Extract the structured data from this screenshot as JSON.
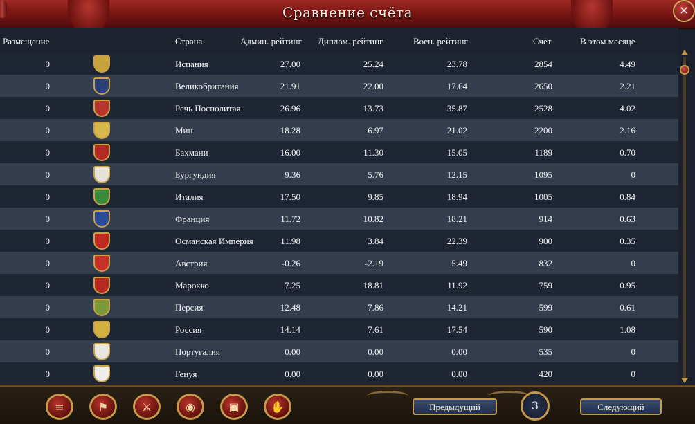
{
  "window": {
    "title": "Сравнение счёта",
    "close_label": "×"
  },
  "columns": {
    "placement": "Размещение",
    "country": "Страна",
    "admin": "Админ. рейтинг",
    "diplo": "Диплом. рейтинг",
    "military": "Воен. рейтинг",
    "score": "Счёт",
    "monthly": "В этом месяце"
  },
  "rows": [
    {
      "placement": "0",
      "country": "Испания",
      "admin": "27.00",
      "diplo": "25.24",
      "military": "23.78",
      "score": "2854",
      "monthly": "4.49",
      "flag_color": "#c8a23a"
    },
    {
      "placement": "0",
      "country": "Великобритания",
      "admin": "21.91",
      "diplo": "22.00",
      "military": "17.64",
      "score": "2650",
      "monthly": "2.21",
      "flag_color": "#2b3f7a"
    },
    {
      "placement": "0",
      "country": "Речь Посполитая",
      "admin": "26.96",
      "diplo": "13.73",
      "military": "35.87",
      "score": "2528",
      "monthly": "4.02",
      "flag_color": "#b8362e"
    },
    {
      "placement": "0",
      "country": "Мин",
      "admin": "18.28",
      "diplo": "6.97",
      "military": "21.02",
      "score": "2200",
      "monthly": "2.16",
      "flag_color": "#d8b84a"
    },
    {
      "placement": "0",
      "country": "Бахмани",
      "admin": "16.00",
      "diplo": "11.30",
      "military": "15.05",
      "score": "1189",
      "monthly": "0.70",
      "flag_color": "#b32a24"
    },
    {
      "placement": "0",
      "country": "Бургундия",
      "admin": "9.36",
      "diplo": "5.76",
      "military": "12.15",
      "score": "1095",
      "monthly": "0",
      "flag_color": "#e6e2d8"
    },
    {
      "placement": "0",
      "country": "Италия",
      "admin": "17.50",
      "diplo": "9.85",
      "military": "18.94",
      "score": "1005",
      "monthly": "0.84",
      "flag_color": "#3a8a3c"
    },
    {
      "placement": "0",
      "country": "Франция",
      "admin": "11.72",
      "diplo": "10.82",
      "military": "18.21",
      "score": "914",
      "monthly": "0.63",
      "flag_color": "#2a4a9a"
    },
    {
      "placement": "0",
      "country": "Османская Империя",
      "admin": "11.98",
      "diplo": "3.84",
      "military": "22.39",
      "score": "900",
      "monthly": "0.35",
      "flag_color": "#c02a22"
    },
    {
      "placement": "0",
      "country": "Австрия",
      "admin": "-0.26",
      "diplo": "-2.19",
      "military": "5.49",
      "score": "832",
      "monthly": "0",
      "flag_color": "#c8302a"
    },
    {
      "placement": "0",
      "country": "Марокко",
      "admin": "7.25",
      "diplo": "18.81",
      "military": "11.92",
      "score": "759",
      "monthly": "0.95",
      "flag_color": "#b62a22"
    },
    {
      "placement": "0",
      "country": "Персия",
      "admin": "12.48",
      "diplo": "7.86",
      "military": "14.21",
      "score": "599",
      "monthly": "0.61",
      "flag_color": "#7a9a3a"
    },
    {
      "placement": "0",
      "country": "Россия",
      "admin": "14.14",
      "diplo": "7.61",
      "military": "17.54",
      "score": "590",
      "monthly": "1.08",
      "flag_color": "#d4b040"
    },
    {
      "placement": "0",
      "country": "Португалия",
      "admin": "0.00",
      "diplo": "0.00",
      "military": "0.00",
      "score": "535",
      "monthly": "0",
      "flag_color": "#e8e6e0"
    },
    {
      "placement": "0",
      "country": "Генуя",
      "admin": "0.00",
      "diplo": "0.00",
      "military": "0.00",
      "score": "420",
      "monthly": "0",
      "flag_color": "#f0ecea"
    }
  ],
  "toolbar": [
    {
      "name": "ledger-button",
      "icon": "≡"
    },
    {
      "name": "flag-button",
      "icon": "⚑"
    },
    {
      "name": "swords-button",
      "icon": "⚔"
    },
    {
      "name": "coins-button",
      "icon": "◉"
    },
    {
      "name": "crates-button",
      "icon": "▣"
    },
    {
      "name": "handshake-button",
      "icon": "✋"
    }
  ],
  "pagination": {
    "prev_label": "Предыдущий",
    "page": "3",
    "next_label": "Следующий"
  },
  "colors": {
    "title_bar": "#7c1714",
    "row_dark": "#1e2633",
    "row_light": "#333d4e",
    "gold": "#c59a4a"
  }
}
